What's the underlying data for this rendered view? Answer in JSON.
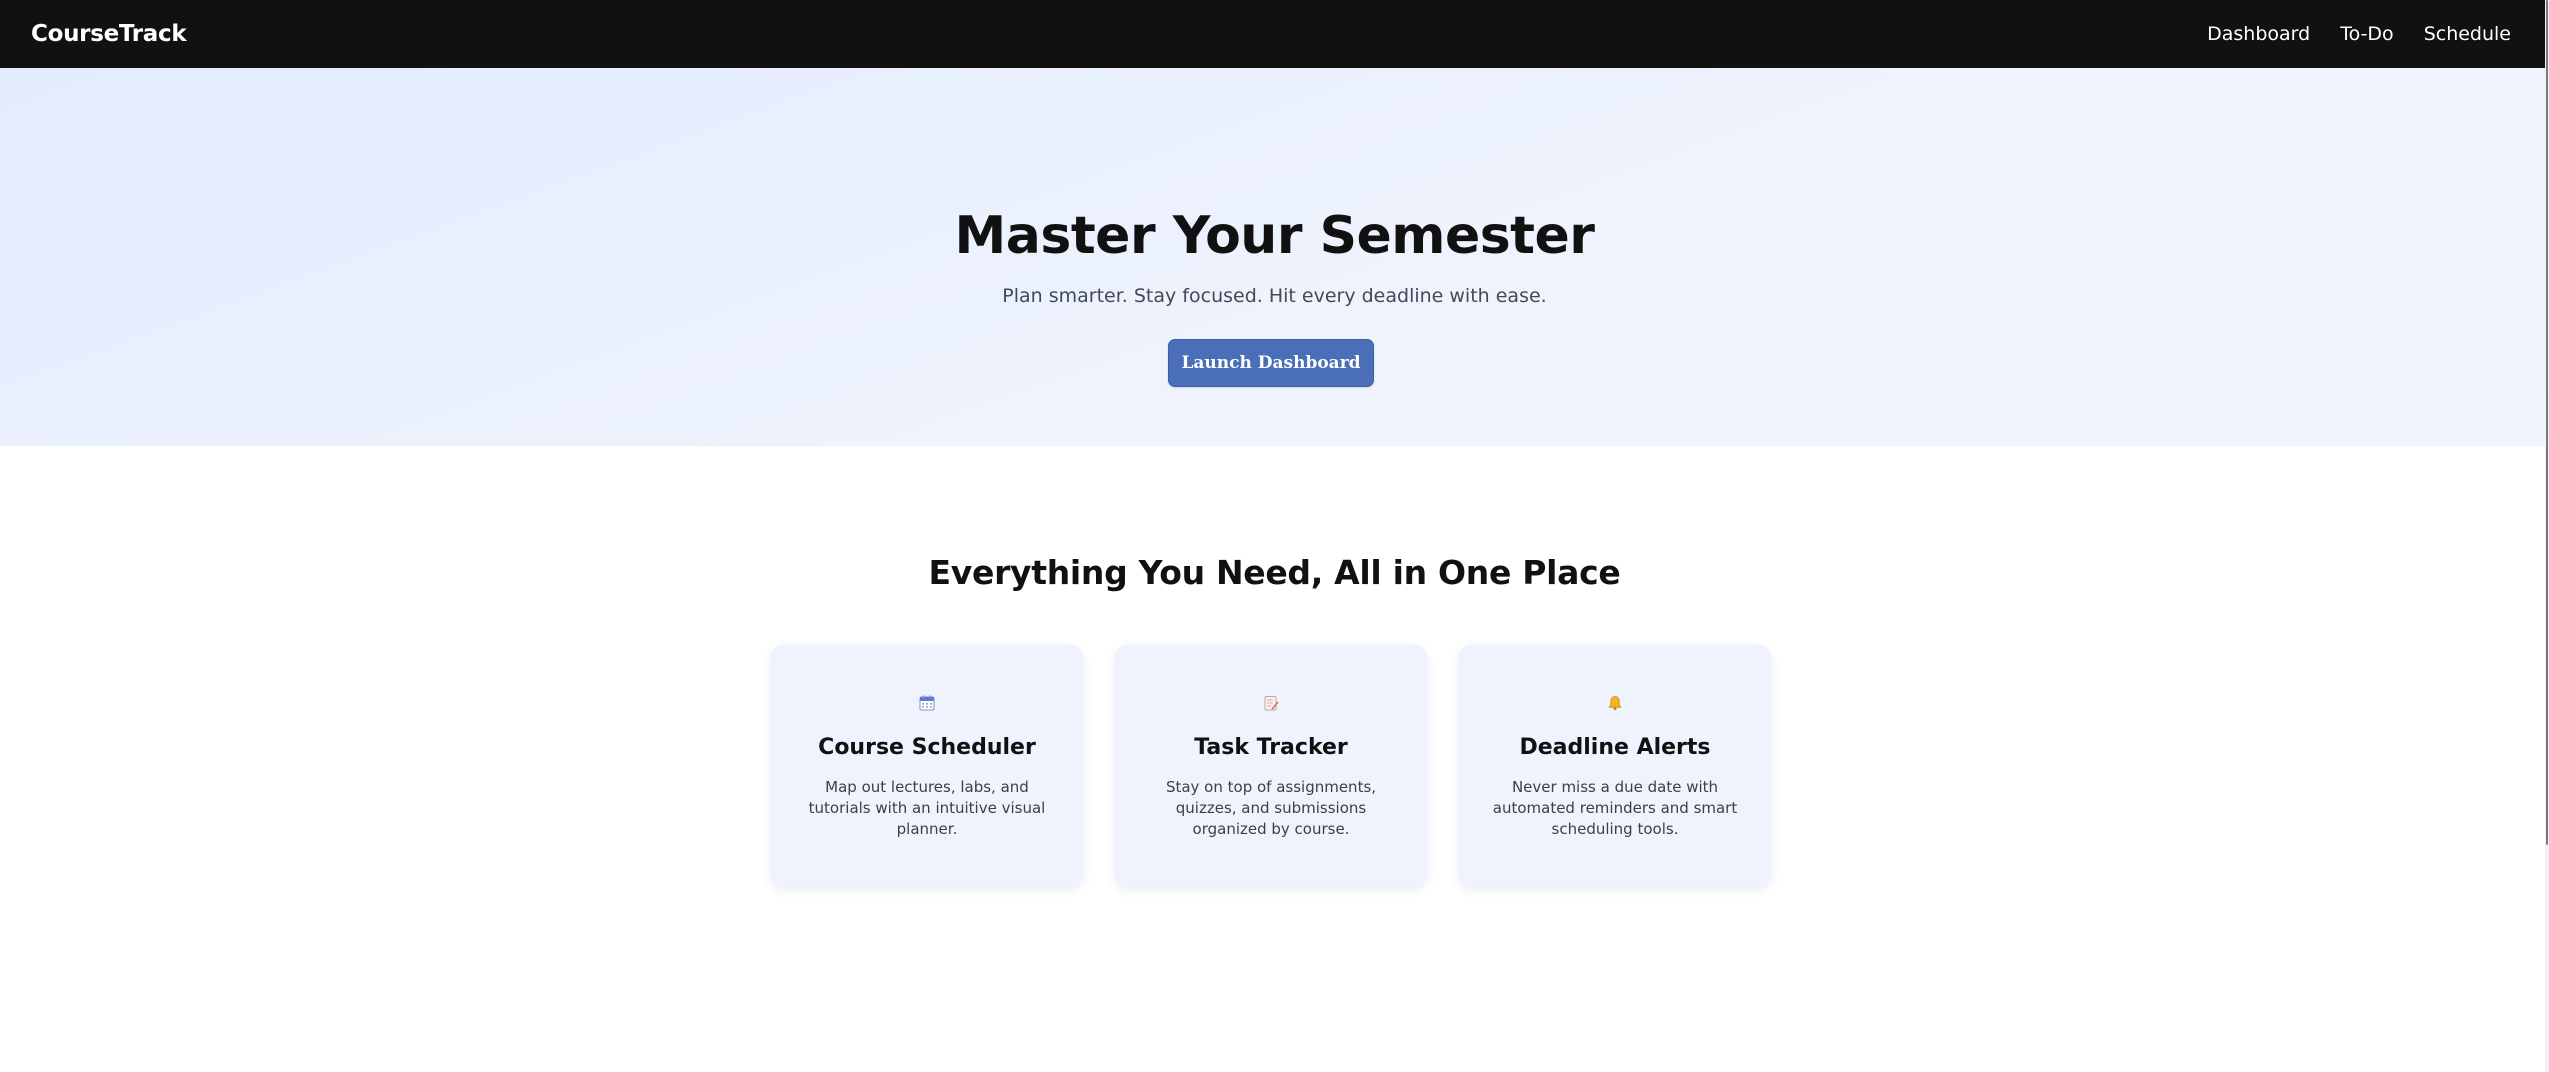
{
  "navbar": {
    "brand": "CourseTrack",
    "links": [
      "Dashboard",
      "To-Do",
      "Schedule"
    ]
  },
  "hero": {
    "title": "Master Your Semester",
    "subtitle": "Plan smarter. Stay focused. Hit every deadline with ease.",
    "cta_label": "Launch Dashboard"
  },
  "features": {
    "title": "Everything You Need, All in One Place",
    "cards": [
      {
        "icon": "calendar-icon",
        "title": "Course Scheduler",
        "description": "Map out lectures, labs, and tutorials with an intuitive visual planner."
      },
      {
        "icon": "memo-icon",
        "title": "Task Tracker",
        "description": "Stay on top of assignments, quizzes, and submissions organized by course."
      },
      {
        "icon": "bell-icon",
        "title": "Deadline Alerts",
        "description": "Never miss a due date with automated reminders and smart scheduling tools."
      }
    ]
  },
  "colors": {
    "navbar_bg": "#111111",
    "hero_bg": "#e8effd",
    "cta_bg": "#4a6fb8",
    "card_bg": "#eef3fe"
  }
}
